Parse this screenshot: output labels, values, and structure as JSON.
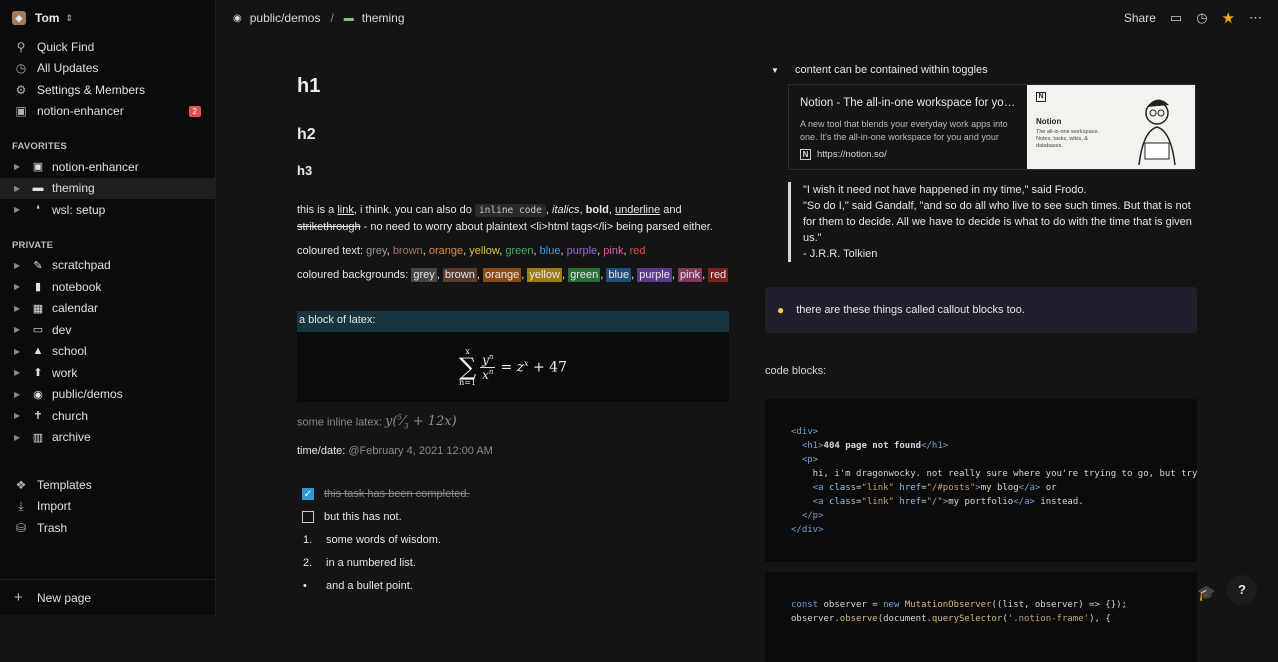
{
  "workspace": {
    "name": "Tom"
  },
  "nav": [
    {
      "label": "Quick Find",
      "icon": "search-icon",
      "glyph": "⚲"
    },
    {
      "label": "All Updates",
      "icon": "clock-icon",
      "glyph": "◷"
    },
    {
      "label": "Settings & Members",
      "icon": "gear-icon",
      "glyph": "⚙"
    },
    {
      "label": "notion-enhancer",
      "icon": "enhancer-icon",
      "glyph": "▣",
      "badge": "2"
    }
  ],
  "favorites_label": "FAVORITES",
  "favorites": [
    {
      "label": "notion-enhancer",
      "glyph": "▣"
    },
    {
      "label": "theming",
      "glyph": "▬"
    },
    {
      "label": "wsl: setup",
      "glyph": "❛"
    }
  ],
  "private_label": "PRIVATE",
  "private": [
    {
      "label": "scratchpad",
      "glyph": "✎"
    },
    {
      "label": "notebook",
      "glyph": "▮"
    },
    {
      "label": "calendar",
      "glyph": "▦"
    },
    {
      "label": "dev",
      "glyph": "▭"
    },
    {
      "label": "school",
      "glyph": "▲"
    },
    {
      "label": "work",
      "glyph": "⬆"
    },
    {
      "label": "public/demos",
      "glyph": "◉"
    },
    {
      "label": "church",
      "glyph": "✝"
    },
    {
      "label": "archive",
      "glyph": "▥"
    }
  ],
  "bottom_nav": [
    {
      "label": "Templates",
      "glyph": "❖"
    },
    {
      "label": "Import",
      "glyph": "⤓"
    },
    {
      "label": "Trash",
      "glyph": "⛁"
    }
  ],
  "new_page": "New page",
  "breadcrumb": {
    "parent": "public/demos",
    "sep": "/",
    "current": "theming"
  },
  "topbar": {
    "share": "Share"
  },
  "content": {
    "h1": "h1",
    "h2": "h2",
    "h3": "h3",
    "p1_a": "this is a ",
    "p1_link": "link",
    "p1_b": ", i think. you can also do ",
    "p1_code": "inline code",
    "p1_c": ", ",
    "p1_italic": "italics",
    "p1_d": ", ",
    "p1_bold": "bold",
    "p1_e": ", ",
    "p1_underline": "underline",
    "p1_f": " and ",
    "p1_strike": "strikethrough",
    "p1_g": " - no need to worry about plaintext <li>html tags</li> being parsed either.",
    "coloured_text_label": "coloured text: ",
    "coloured_bg_label": "coloured backgrounds: ",
    "colours": [
      {
        "name": "grey",
        "fg": "#9b9b9b",
        "bg": "#454545"
      },
      {
        "name": "brown",
        "fg": "#a3785f",
        "bg": "#5a3b2b"
      },
      {
        "name": "orange",
        "fg": "#e08b3a",
        "bg": "#8a4c15"
      },
      {
        "name": "yellow",
        "fg": "#e0c23a",
        "bg": "#9a7d10"
      },
      {
        "name": "green",
        "fg": "#4dab63",
        "bg": "#2a6d36"
      },
      {
        "name": "blue",
        "fg": "#4a9ad9",
        "bg": "#1e4f78"
      },
      {
        "name": "purple",
        "fg": "#9a6ad9",
        "bg": "#573a8a"
      },
      {
        "name": "pink",
        "fg": "#d961a8",
        "bg": "#82375f"
      },
      {
        "name": "red",
        "fg": "#d9534f",
        "bg": "#7a2222"
      }
    ],
    "latex_label": "a block of latex:",
    "inline_latex_label": "some inline latex: ",
    "time_label": "time/date: ",
    "time_value": "@February 4, 2021 12:00 AM",
    "todo_done": "this task has been completed.",
    "todo_open": "but this has not.",
    "num1": "some words of wisdom.",
    "num2": "in a numbered list.",
    "bullet": "and a bullet point.",
    "toggle": "content can be contained within toggles",
    "bookmark": {
      "title": "Notion - The all-in-one workspace for your notes, tasks, wikis, and databases.",
      "desc": "A new tool that blends your everyday work apps into one. It's the all-in-one workspace for you and your team",
      "url": "https://notion.so/",
      "img_title": "Notion",
      "img_sub": "The all-in-one workspace. Notes, tasks, wikis, & databases."
    },
    "quote": [
      "\"I wish it need not have happened in my time,\" said Frodo.",
      "\"So do I,\" said Gandalf, \"and so do all who live to see such times. But that is not for them to decide. All we have to decide is what to do with the time that is given us.\"",
      "- J.R.R. Tolkien"
    ],
    "callout": "there are these things called callout blocks too.",
    "code_label": "code blocks:"
  },
  "colors": {
    "accent": "#2e9bd5",
    "favorite_star": "#f2a516",
    "badge": "#e05252"
  }
}
